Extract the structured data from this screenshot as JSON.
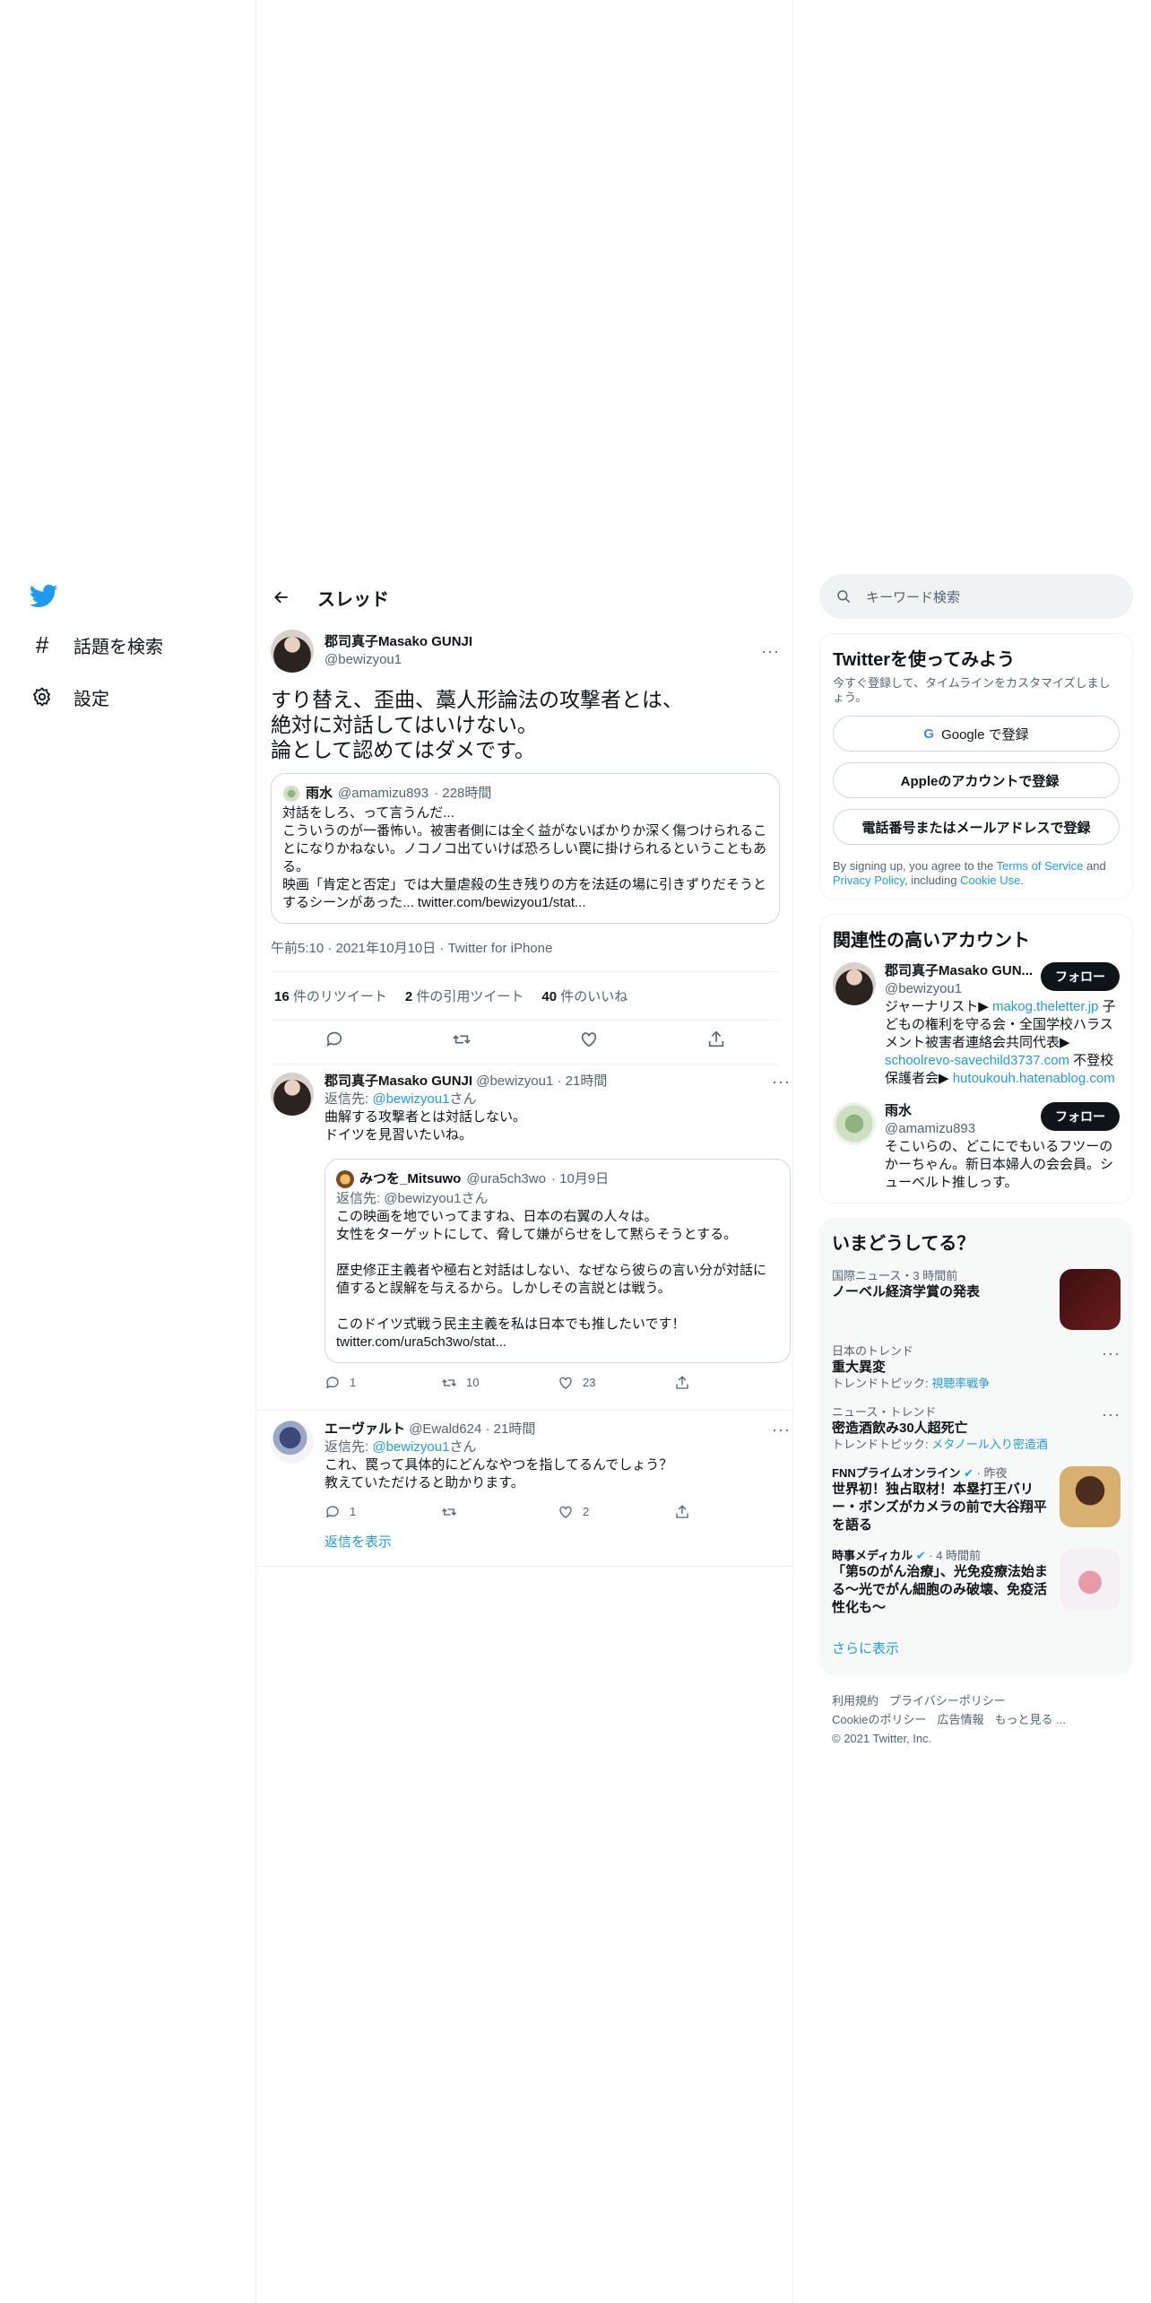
{
  "nav": {
    "explore": "話題を検索",
    "settings": "設定"
  },
  "header": {
    "title": "スレッド"
  },
  "main_tweet": {
    "name": "郡司真子Masako GUNJI",
    "handle": "@bewizyou1",
    "text": "すり替え、歪曲、藁人形論法の攻撃者とは、\n絶対に対話してはいけない。\n論として認めてはダメです。",
    "quote": {
      "name": "雨水",
      "handle": "@amamizu893",
      "time": "· 228時間",
      "text": "対話をしろ、って言うんだ...\nこういうのが一番怖い。被害者側には全く益がないばかりか深く傷つけられることになりかねない。ノコノコ出ていけば恐ろしい罠に掛けられるということもある。\n映画「肯定と否定」では大量虐殺の生き残りの方を法廷の場に引きずりだそうとするシーンがあった... twitter.com/bewizyou1/stat..."
    },
    "meta": "午前5:10 · 2021年10月10日 · Twitter for iPhone",
    "retweets_count": "16",
    "retweets_label": "件のリツイート",
    "quotes_count": "2",
    "quotes_label": "件の引用ツイート",
    "likes_count": "40",
    "likes_label": "件のいいね"
  },
  "reply1": {
    "name": "郡司真子Masako GUNJI",
    "handle": "@bewizyou1",
    "time": "· 21時間",
    "reply_to_prefix": "返信先: ",
    "reply_to_handle": "@bewizyou1",
    "reply_to_suffix": "さん",
    "text": "曲解する攻撃者とは対話しない。\nドイツを見習いたいね。",
    "quote": {
      "name": "みつを_Mitsuwo",
      "handle": "@ura5ch3wo",
      "time": "· 10月9日",
      "reply_to": "返信先: @bewizyou1さん",
      "text": "この映画を地でいってますね、日本の右翼の人々は。\n女性をターゲットにして、脅して嫌がらせをして黙らそうとする。\n\n歴史修正主義者や極右と対話はしない、なぜなら彼らの言い分が対話に値すると誤解を与えるから。しかしその言説とは戦う。\n\nこのドイツ式戦う民主主義を私は日本でも推したいです！\ntwitter.com/ura5ch3wo/stat..."
    },
    "replies": "1",
    "retweets": "10",
    "likes": "23"
  },
  "reply2": {
    "name": "エーヴァルト",
    "handle": "@Ewald624",
    "time": "· 21時間",
    "reply_to_prefix": "返信先: ",
    "reply_to_handle": "@bewizyou1",
    "reply_to_suffix": "さん",
    "text": "これ、罠って具体的にどんなやつを指してるんでしょう？\n教えていただけると助かります。",
    "replies": "1",
    "likes": "2",
    "show_replies": "返信を表示"
  },
  "search": {
    "placeholder": "キーワード検索"
  },
  "signup": {
    "title": "Twitterを使ってみよう",
    "subtitle": "今すぐ登録して、タイムラインをカスタマイズしましょう。",
    "google": "Google で登録",
    "apple": "Appleのアカウントで登録",
    "phone": "電話番号またはメールアドレスで登録",
    "legal_1": "By signing up, you agree to the ",
    "terms": "Terms of Service",
    "legal_2": " and ",
    "privacy": "Privacy Policy",
    "legal_3": ", including ",
    "cookie": "Cookie Use",
    "legal_4": "."
  },
  "related": {
    "title": "関連性の高いアカウント",
    "follow": "フォロー",
    "acc1": {
      "name": "郡司真子Masako GUN...",
      "handle": "@bewizyou1",
      "bio_1": "ジャーナリスト▶ ",
      "link1": "makog.theletter.jp",
      "bio_2": " 子どもの権利を守る会・全国学校ハラスメント被害者連絡会共同代表▶ ",
      "link2": "schoolrevo-savechild3737.com",
      "bio_3": " 不登校保護者会▶ ",
      "link3": "hutoukouh.hatenablog.com"
    },
    "acc2": {
      "name": "雨水",
      "handle": "@amamizu893",
      "bio": "そこいらの、どこにでもいるフツーのかーちゃん。新日本婦人の会会員。シューベルト推しっす。"
    }
  },
  "trends": {
    "title": "いまどうしてる？",
    "t1": {
      "meta": "国際ニュース・3 時間前",
      "title": "ノーベル経済学賞の発表"
    },
    "t2": {
      "meta": "日本のトレンド",
      "title": "重大異変",
      "topic_label": "トレンドトピック: ",
      "topic": "視聴率戦争"
    },
    "t3": {
      "meta": "ニュース・トレンド",
      "title": "密造酒飲み30人超死亡",
      "topic_label": "トレンドトピック: ",
      "topic": "メタノール入り密造酒"
    },
    "t4": {
      "source": "FNNプライムオンライン",
      "time": "· 昨夜",
      "title": "世界初！独占取材！本塁打王バリー・ボンズがカメラの前で大谷翔平を語る"
    },
    "t5": {
      "source": "時事メディカル",
      "time": "· 4 時間前",
      "title": "「第5のがん治療」、光免疫療法始まる～光でがん細胞のみ破壊、免疫活性化も～"
    },
    "more": "さらに表示"
  },
  "footer": {
    "terms": "利用規約",
    "privacy": "プライバシーポリシー",
    "cookie": "Cookieのポリシー",
    "ads": "広告情報",
    "more": "もっと見る ...",
    "copyright": "© 2021 Twitter, Inc."
  },
  "colors": {
    "accent": "#1d9bf0",
    "text": "#0f1419",
    "muted": "#536471"
  }
}
